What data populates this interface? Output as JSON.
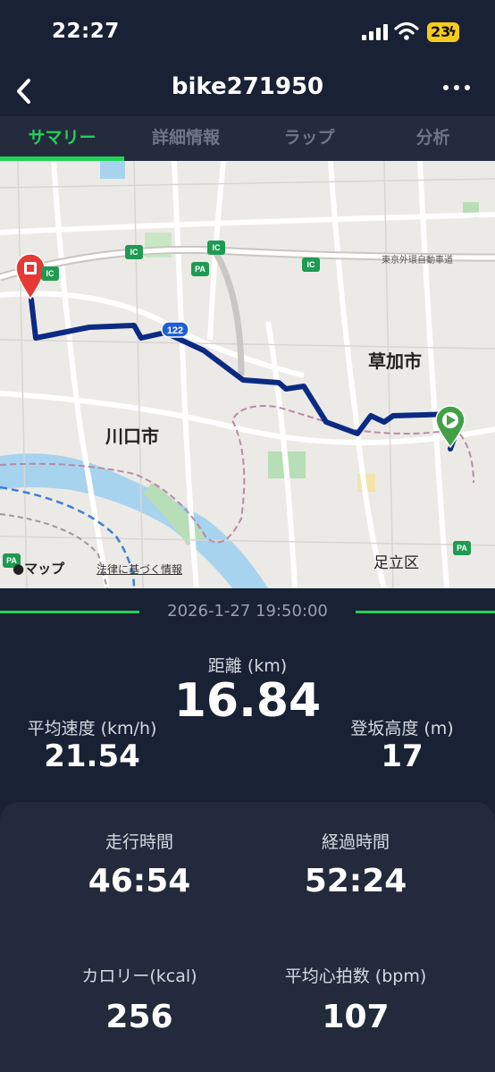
{
  "status_bar": {
    "time": "22:27",
    "battery": "23"
  },
  "nav": {
    "title": "bike271950"
  },
  "tabs": [
    {
      "label": "サマリー",
      "active": true
    },
    {
      "label": "詳細情報",
      "active": false
    },
    {
      "label": "ラップ",
      "active": false
    },
    {
      "label": "分析",
      "active": false
    }
  ],
  "map": {
    "labels": {
      "sohka": "草加市",
      "kawaguchi": "川口市",
      "adachi": "足立区",
      "expressway": "東京外環自動車道",
      "route": "122",
      "ic": "IC",
      "pa": "PA"
    },
    "brand": "マップ",
    "legal": "法律に基づく情報",
    "route_color": "#0b2a84",
    "start_color": "#43a047",
    "end_color": "#e53935"
  },
  "summary": {
    "datetime": "2026-1-27 19:50:00",
    "distance": {
      "label": "距離 (km)",
      "value": "16.84"
    },
    "avg_speed": {
      "label": "平均速度 (km/h)",
      "value": "21.54"
    },
    "climb": {
      "label": "登坂高度 (m)",
      "value": "17"
    },
    "moving_time": {
      "label": "走行時間",
      "value": "46:54"
    },
    "elapsed_time": {
      "label": "経過時間",
      "value": "52:24"
    },
    "calories": {
      "label": "カロリー(kcal)",
      "value": "256"
    },
    "avg_heart_rate": {
      "label": "平均心拍数 (bpm)",
      "value": "107"
    }
  },
  "accent_color": "#20d258"
}
